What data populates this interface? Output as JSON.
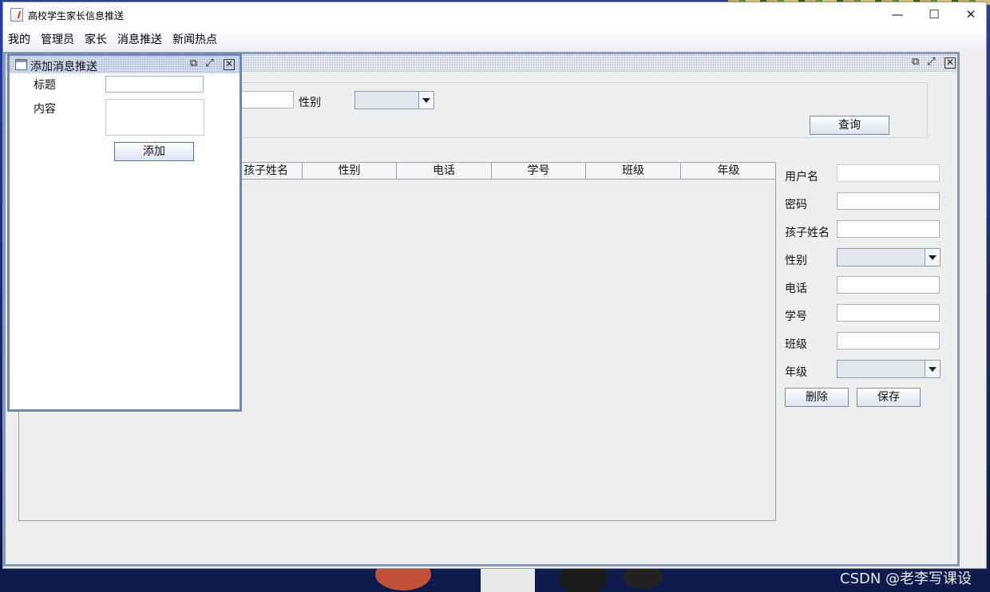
{
  "window": {
    "title": "高校学生家长信息推送",
    "minimize_glyph": "—",
    "maximize_glyph": "☐",
    "close_glyph": "✕"
  },
  "menu": [
    "我的",
    "管理员",
    "家长",
    "消息推送",
    "新闻热点"
  ],
  "add_message_frame": {
    "title": "添加消息推送",
    "title_label": "标题",
    "title_value": "",
    "content_label": "内容",
    "content_value": "",
    "add_button": "添加"
  },
  "parent_frame": {
    "filter": {
      "name_value": "",
      "gender_label": "性别",
      "gender_selected": "",
      "query_button": "查询"
    },
    "table": {
      "columns": [
        "孩子姓名",
        "性别",
        "电话",
        "学号",
        "班级",
        "年级"
      ],
      "rows": []
    },
    "form": {
      "username_label": "用户名",
      "password_label": "密码",
      "child_name_label": "孩子姓名",
      "gender_label": "性别",
      "phone_label": "电话",
      "student_id_label": "学号",
      "class_label": "班级",
      "grade_label": "年级",
      "delete_button": "删除",
      "save_button": "保存"
    }
  },
  "frame_buttons": {
    "iconify": "⧉",
    "maximize": "⤢",
    "close": "✕"
  },
  "watermark": "CSDN @老李写课设",
  "colors": {
    "frame_border_active": "#6f86b6",
    "frame_border_inactive": "#8899b8",
    "panel_background": "#eeeeee",
    "desktop_background": "#1b2f7a"
  }
}
